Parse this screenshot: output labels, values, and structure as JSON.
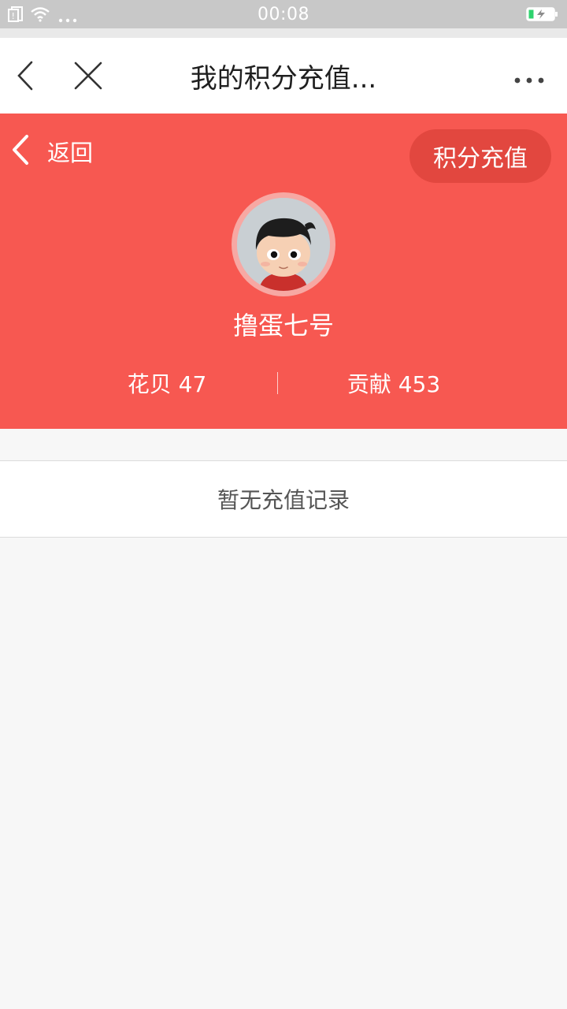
{
  "status_bar": {
    "time": "00:08"
  },
  "nav": {
    "title": "我的积分充值..."
  },
  "header": {
    "back_label": "返回",
    "recharge_label": "积分充值",
    "username": "撸蛋七号",
    "stats": [
      {
        "label": "花贝",
        "value": "47"
      },
      {
        "label": "贡献",
        "value": "453"
      }
    ]
  },
  "records": {
    "empty_text": "暂无充值记录"
  },
  "colors": {
    "accent": "#f75851",
    "button": "#e2473f"
  },
  "icons": [
    "sim-icon",
    "wifi-icon",
    "more-dots-icon",
    "battery-charging-icon",
    "back-chevron-icon",
    "close-icon",
    "avatar-cartoon"
  ]
}
